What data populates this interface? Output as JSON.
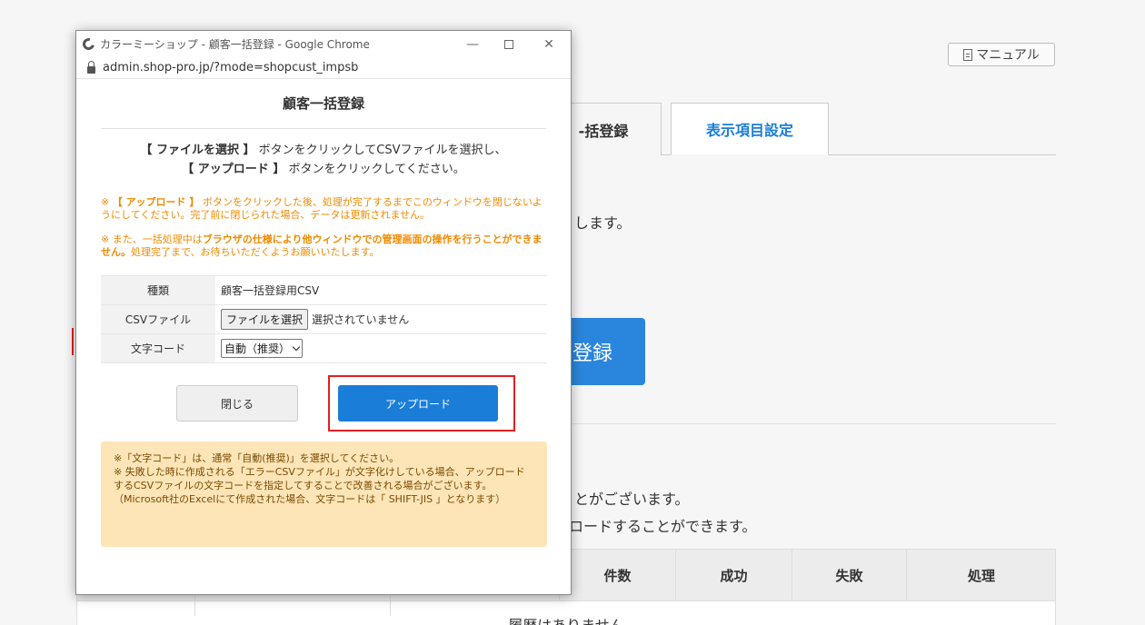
{
  "background": {
    "manual_label": "マニュアル",
    "tab_left_label": "-括登録",
    "tab_right_label": "表示項目設定",
    "text1": "します。",
    "big_button_label": "登録",
    "text2": "とがございます。",
    "text3": "ロードすることができます。",
    "history_headers": [
      "件数",
      "成功",
      "失敗",
      "処理"
    ],
    "history_empty": "履歴はありません"
  },
  "popup": {
    "window_title": "カラーミーショップ - 顧客一括登録 - Google Chrome",
    "address": "admin.shop-pro.jp/?mode=shopcust_impsb",
    "title": "顧客一括登録",
    "instr_l1_bold": "【 ファイルを選択 】",
    "instr_l1_rest": " ボタンをクリックしてCSVファイルを選択し、",
    "instr_l2_bold": "【 アップロード 】",
    "instr_l2_rest": " ボタンをクリックしてください。",
    "warn1_prefix": "※ ",
    "warn1_bold": "【 アップロード 】",
    "warn1_rest": " ボタンをクリックした後、処理が完了するまでこのウィンドウを閉じないようにしてください。完了前に閉じられた場合、データは更新されません。",
    "warn2_prefix": "※ また、一括処理中は",
    "warn2_bold": "ブラウザの仕様により他ウィンドウでの管理画面の操作を行うことができません。",
    "warn2_rest": "処理完了まで、お待ちいただくようお願いいたします。",
    "rows": {
      "type_label": "種類",
      "type_value": "顧客一括登録用CSV",
      "csv_label": "CSVファイル",
      "file_button": "ファイルを選択",
      "file_status": "選択されていません",
      "charset_label": "文字コード",
      "charset_value": "自動（推奨）"
    },
    "close_button": "閉じる",
    "upload_button": "アップロード",
    "note_l1": "※「文字コード」は、通常「自動(推奨)」を選択してください。",
    "note_l2": "※ 失敗した時に作成される「エラーCSVファイル」が文字化けしている場合、アップロードするCSVファイルの文字コードを指定してすることで改善される場合がございます。（Microsoft社のExcelにて作成された場合、文字コードは「 SHIFT-JIS 」となります）"
  },
  "colors": {
    "accent_blue": "#1a7ed8",
    "warning_orange": "#f08a00",
    "highlight_red": "#e02020",
    "note_bg": "#fde5b8"
  }
}
